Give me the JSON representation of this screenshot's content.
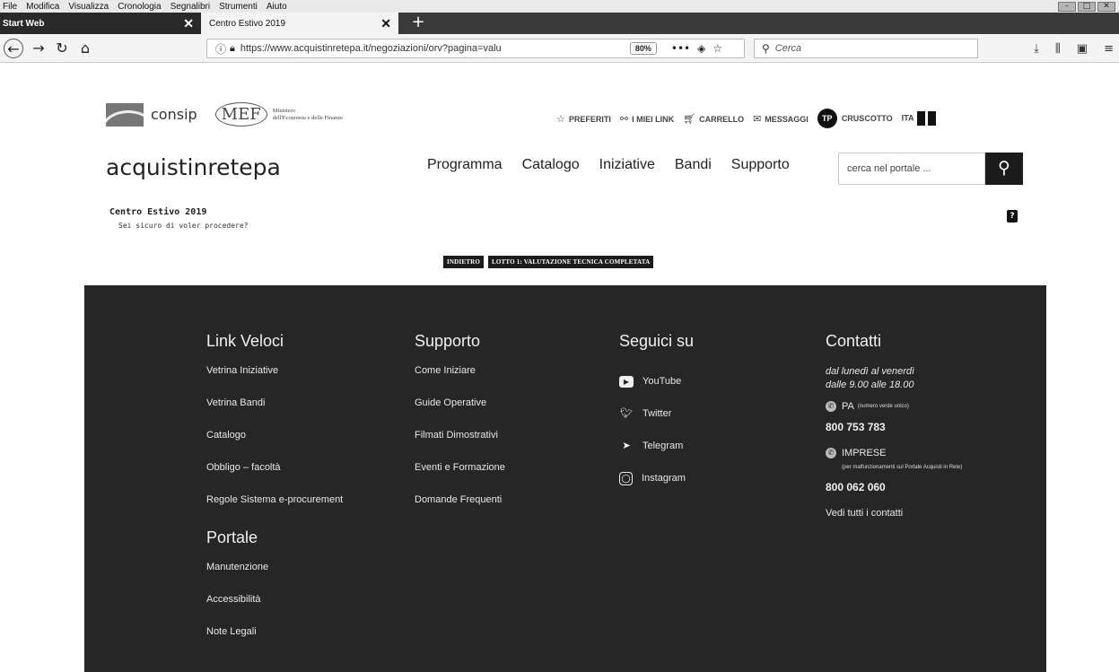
{
  "browser": {
    "menu": [
      "File",
      "Modifica",
      "Visualizza",
      "Cronologia",
      "Segnalibri",
      "Strumenti",
      "Aiuto"
    ],
    "tabs": [
      {
        "label": "Start Web"
      },
      {
        "label": "Centro Estivo 2019"
      }
    ],
    "url": "https://www.acquistinretepa.it/negoziazioni/orv?pagina=valu",
    "zoom": "80%",
    "search_placeholder": "Cerca"
  },
  "header": {
    "consip_label": "consip",
    "mef_mark": "MEF",
    "mef_text_1": "Ministero",
    "mef_text_2": "dell'Economia e delle Finanze",
    "links": {
      "preferiti": "PREFERITI",
      "miei_link": "I MIEI LINK",
      "carrello": "CARRELLO",
      "messaggi": "MESSAGGI",
      "tp_badge": "TP",
      "cruscotto": "CRUSCOTTO",
      "lang": "ITA"
    },
    "brand": "acquistinretepa",
    "nav": [
      "Programma",
      "Catalogo",
      "Iniziative",
      "Bandi",
      "Supporto"
    ],
    "search_placeholder": "cerca nel portale ..."
  },
  "content": {
    "title": "Centro Estivo 2019",
    "subtitle": "Sei sicuro di voler procedere?",
    "buttons": {
      "back": "INDIETRO",
      "confirm": "LOTTO 1: VALUTAZIONE TECNICA COMPLETATA"
    }
  },
  "footer": {
    "link_veloci": {
      "title": "Link Veloci",
      "items": [
        "Vetrina Iniziative",
        "Vetrina Bandi",
        "Catalogo",
        "Obbligo – facoltà",
        "Regole Sistema e-procurement"
      ]
    },
    "portale": {
      "title": "Portale",
      "items": [
        "Manutenzione",
        "Accessibilità",
        "Note Legali"
      ]
    },
    "supporto": {
      "title": "Supporto",
      "items": [
        "Come Iniziare",
        "Guide Operative",
        "Filmati Dimostrativi",
        "Eventi e Formazione",
        "Domande Frequenti"
      ]
    },
    "seguici": {
      "title": "Seguici su",
      "items": [
        "YouTube",
        "Twitter",
        "Telegram",
        "Instagram"
      ]
    },
    "contatti": {
      "title": "Contatti",
      "hours_1": "dal lunedì al venerdì",
      "hours_2": "dalle 9.00 alle 18.00",
      "pa_label": "PA",
      "pa_note": "(numero verde unico)",
      "pa_phone": "800 753 783",
      "imprese_label": "IMPRESE",
      "imprese_note": "(per malfunzionamenti sul Portale Acquisti in Rete)",
      "imprese_phone": "800 062 060",
      "all_contacts": "Vedi tutti i contatti"
    }
  }
}
